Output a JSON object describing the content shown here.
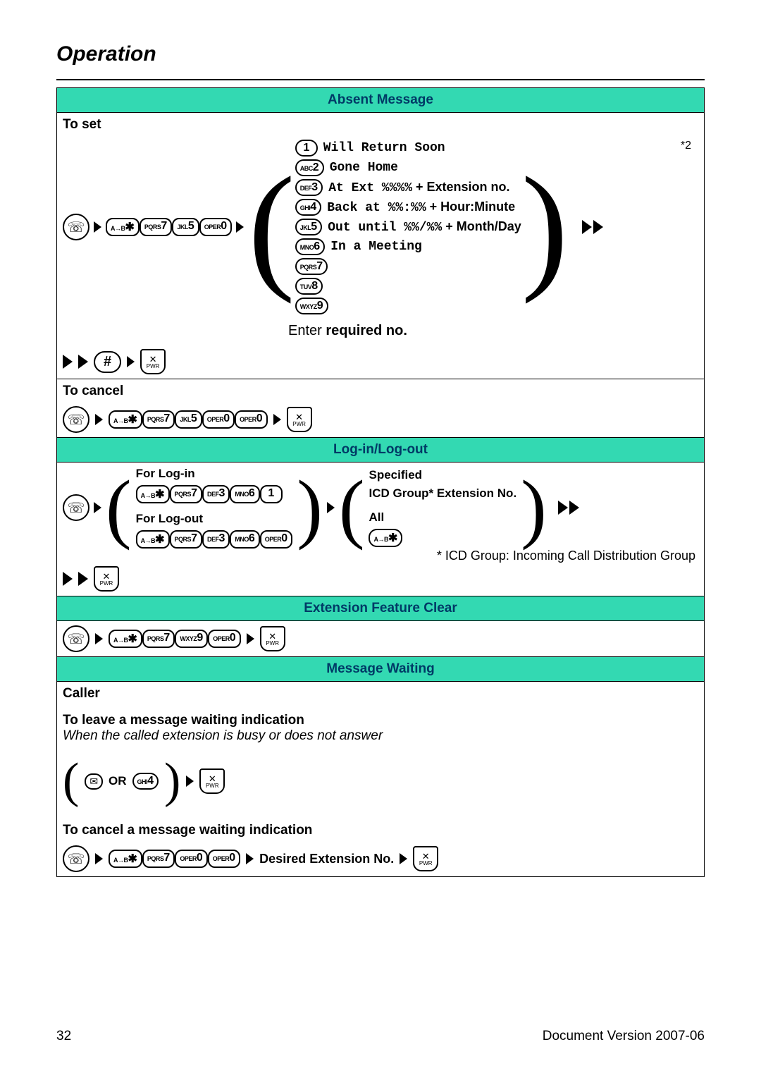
{
  "page_title": "Operation",
  "footer": {
    "page": "32",
    "version_label": "Document Version 2007-06"
  },
  "sections": {
    "absent": {
      "header": "Absent Message",
      "to_set": "To set",
      "to_cancel": "To cancel",
      "star_note": "*2",
      "enter_caption_pre": "Enter ",
      "enter_caption_bold": "required no.",
      "options": {
        "o1": "Will Return Soon",
        "o2": "Gone Home",
        "o3_pre": "At Ext %%%%",
        "o3_suf": " + Extension no.",
        "o4_pre": "Back at %%:%%",
        "o4_suf": " + Hour:Minute",
        "o5_pre": "Out until %%/%%",
        "o5_suf": " + Month/Day",
        "o6": "In a Meeting"
      }
    },
    "login": {
      "header": "Log-in/Log-out",
      "for_login": "For Log-in",
      "for_logout": "For Log-out",
      "specified": "Specified",
      "icd_line": "ICD Group* Extension No.",
      "all": "All",
      "footnote": "* ICD Group: Incoming Call Distribution Group"
    },
    "efc": {
      "header": "Extension Feature Clear"
    },
    "mw": {
      "header": "Message Waiting",
      "caller": "Caller",
      "leave_title": "To leave a message waiting indication",
      "leave_sub": "When the called extension is busy or does not answer",
      "or": "OR",
      "cancel_title": "To cancel a message waiting indication",
      "desired_ext": "Desired Extension No."
    }
  },
  "keys": {
    "star_sm": "A→B",
    "star_big": "✱",
    "k1": "1",
    "k2_sm": "ABC",
    "k2": "2",
    "k3_sm": "DEF",
    "k3": "3",
    "k4_sm": "GHI",
    "k4": "4",
    "k5_sm": "JKL",
    "k5": "5",
    "k6_sm": "MNO",
    "k6": "6",
    "k7_sm": "PQRS",
    "k7": "7",
    "k8_sm": "TUV",
    "k8": "8",
    "k9_sm": "WXYZ",
    "k9": "9",
    "k0_sm": "OPER",
    "k0": "0",
    "hash": "#",
    "pwr": "PWR"
  }
}
